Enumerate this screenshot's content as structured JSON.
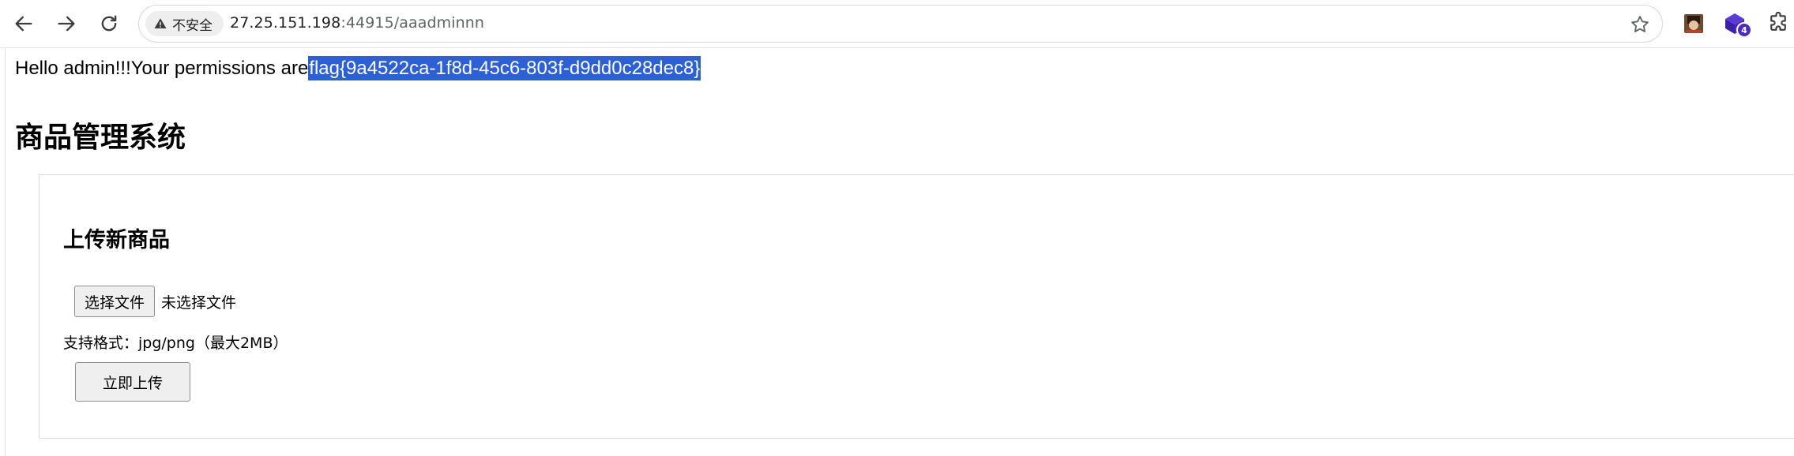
{
  "browser": {
    "security_label": "不安全",
    "url_host": "27.25.151.198",
    "url_rest": ":44915/aaadminnn",
    "extension_badge_count": "4"
  },
  "page": {
    "greeting": "Hello admin!!!Your permissions are",
    "flag": "flag{9a4522ca-1f8d-45c6-803f-d9dd0c28dec8}",
    "title": "商品管理系统",
    "upload_section": {
      "heading": "上传新商品",
      "choose_file_label": "选择文件",
      "file_status": "未选择文件",
      "format_hint": "支持格式：jpg/png（最大2MB）",
      "submit_label": "立即上传"
    }
  }
}
